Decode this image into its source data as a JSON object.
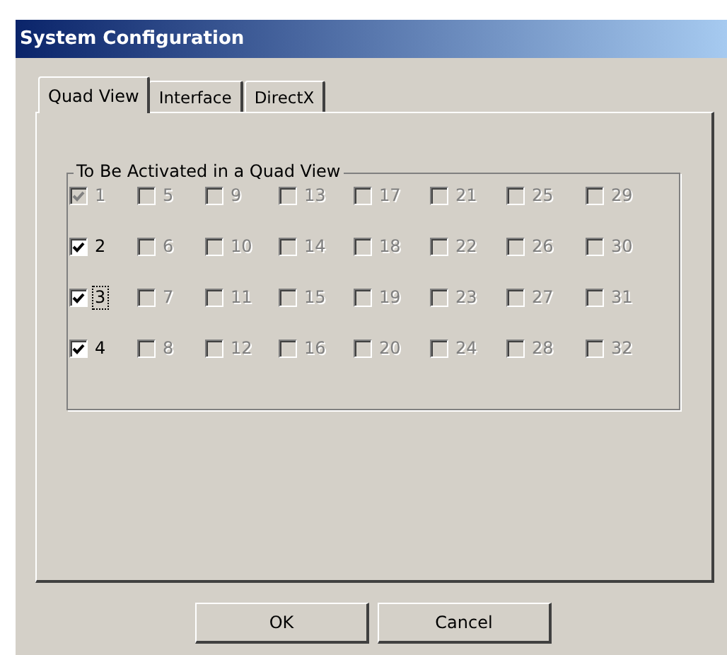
{
  "window": {
    "title": "System Configuration"
  },
  "tabs": [
    {
      "label": "Quad View",
      "selected": true
    },
    {
      "label": "Interface",
      "selected": false
    },
    {
      "label": "DirectX",
      "selected": false
    }
  ],
  "group": {
    "title": "To Be Activated in a Quad View",
    "checkboxes": [
      {
        "label": "1",
        "checked": true,
        "disabled": true,
        "focused": false
      },
      {
        "label": "2",
        "checked": true,
        "disabled": false,
        "focused": false
      },
      {
        "label": "3",
        "checked": true,
        "disabled": false,
        "focused": true
      },
      {
        "label": "4",
        "checked": true,
        "disabled": false,
        "focused": false
      },
      {
        "label": "5",
        "checked": false,
        "disabled": true,
        "focused": false
      },
      {
        "label": "6",
        "checked": false,
        "disabled": true,
        "focused": false
      },
      {
        "label": "7",
        "checked": false,
        "disabled": true,
        "focused": false
      },
      {
        "label": "8",
        "checked": false,
        "disabled": true,
        "focused": false
      },
      {
        "label": "9",
        "checked": false,
        "disabled": true,
        "focused": false
      },
      {
        "label": "10",
        "checked": false,
        "disabled": true,
        "focused": false
      },
      {
        "label": "11",
        "checked": false,
        "disabled": true,
        "focused": false
      },
      {
        "label": "12",
        "checked": false,
        "disabled": true,
        "focused": false
      },
      {
        "label": "13",
        "checked": false,
        "disabled": true,
        "focused": false
      },
      {
        "label": "14",
        "checked": false,
        "disabled": true,
        "focused": false
      },
      {
        "label": "15",
        "checked": false,
        "disabled": true,
        "focused": false
      },
      {
        "label": "16",
        "checked": false,
        "disabled": true,
        "focused": false
      },
      {
        "label": "17",
        "checked": false,
        "disabled": true,
        "focused": false
      },
      {
        "label": "18",
        "checked": false,
        "disabled": true,
        "focused": false
      },
      {
        "label": "19",
        "checked": false,
        "disabled": true,
        "focused": false
      },
      {
        "label": "20",
        "checked": false,
        "disabled": true,
        "focused": false
      },
      {
        "label": "21",
        "checked": false,
        "disabled": true,
        "focused": false
      },
      {
        "label": "22",
        "checked": false,
        "disabled": true,
        "focused": false
      },
      {
        "label": "23",
        "checked": false,
        "disabled": true,
        "focused": false
      },
      {
        "label": "24",
        "checked": false,
        "disabled": true,
        "focused": false
      },
      {
        "label": "25",
        "checked": false,
        "disabled": true,
        "focused": false
      },
      {
        "label": "26",
        "checked": false,
        "disabled": true,
        "focused": false
      },
      {
        "label": "27",
        "checked": false,
        "disabled": true,
        "focused": false
      },
      {
        "label": "28",
        "checked": false,
        "disabled": true,
        "focused": false
      },
      {
        "label": "29",
        "checked": false,
        "disabled": true,
        "focused": false
      },
      {
        "label": "30",
        "checked": false,
        "disabled": true,
        "focused": false
      },
      {
        "label": "31",
        "checked": false,
        "disabled": true,
        "focused": false
      },
      {
        "label": "32",
        "checked": false,
        "disabled": true,
        "focused": false
      }
    ]
  },
  "buttons": [
    {
      "label": "OK"
    },
    {
      "label": "Cancel"
    }
  ]
}
